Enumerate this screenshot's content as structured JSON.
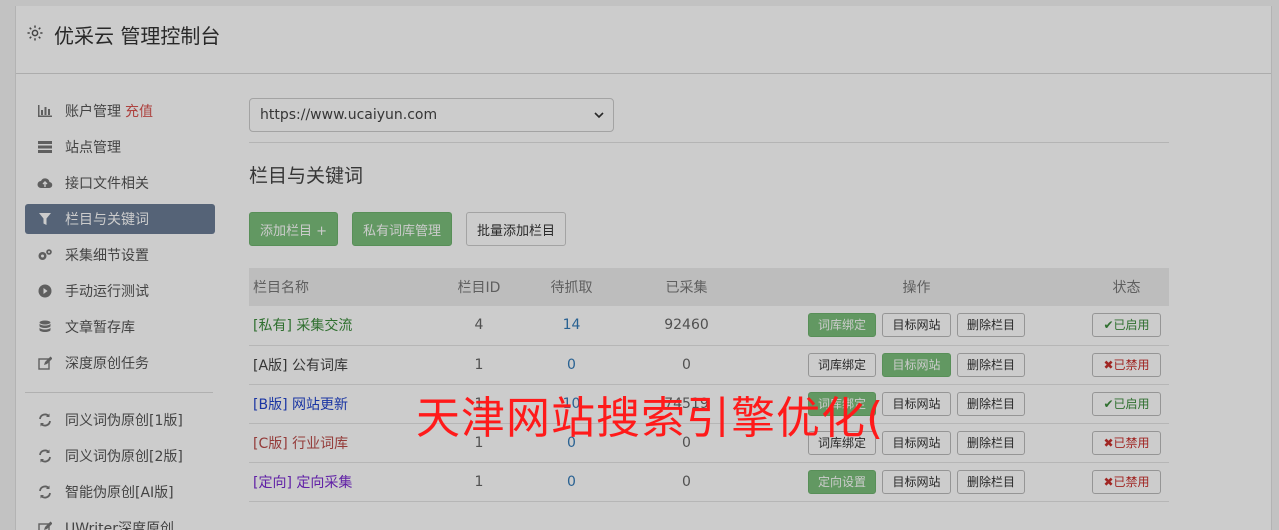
{
  "header": {
    "title": "优采云 管理控制台"
  },
  "sidebar": {
    "items": [
      {
        "label": "账户管理",
        "extra": "充值",
        "icon": "bar-chart-icon"
      },
      {
        "label": "站点管理",
        "icon": "server-icon"
      },
      {
        "label": "接口文件相关",
        "icon": "cloud-upload-icon"
      },
      {
        "label": "栏目与关键词",
        "icon": "filter-icon",
        "active": true
      },
      {
        "label": "采集细节设置",
        "icon": "cogs-icon"
      },
      {
        "label": "手动运行测试",
        "icon": "play-circle-icon"
      },
      {
        "label": "文章暂存库",
        "icon": "database-icon"
      },
      {
        "label": "深度原创任务",
        "icon": "edit-icon"
      }
    ],
    "items2": [
      {
        "label": "同义词伪原创[1版]",
        "icon": "refresh-icon"
      },
      {
        "label": "同义词伪原创[2版]",
        "icon": "refresh-icon"
      },
      {
        "label": "智能伪原创[AI版]",
        "icon": "refresh-icon"
      },
      {
        "label": "UWriter深度原创",
        "icon": "edit-icon"
      }
    ]
  },
  "main": {
    "site_select_value": "https://www.ucaiyun.com",
    "section_title": "栏目与关键词",
    "buttons": {
      "add_column": "添加栏目 +",
      "private_lexicon": "私有词库管理",
      "batch_add": "批量添加栏目"
    },
    "table": {
      "headers": [
        "栏目名称",
        "栏目ID",
        "待抓取",
        "已采集",
        "操作",
        "状态"
      ],
      "rows": [
        {
          "name": "[私有] 采集交流",
          "id": "4",
          "pending": "14",
          "collected": "92460",
          "op1": "词库绑定",
          "op2": "目标网站",
          "op3": "删除栏目",
          "status": "已启用"
        },
        {
          "name": "[A版] 公有词库",
          "id": "1",
          "pending": "0",
          "collected": "0",
          "op1": "词库绑定",
          "op2": "目标网站",
          "op3": "删除栏目",
          "status": "已禁用"
        },
        {
          "name": "[B版] 网站更新",
          "id": "1",
          "pending": "10",
          "collected": "74519",
          "op1": "词库绑定",
          "op2": "目标网站",
          "op3": "删除栏目",
          "status": "已启用"
        },
        {
          "name": "[C版] 行业词库",
          "id": "1",
          "pending": "0",
          "collected": "0",
          "op1": "词库绑定",
          "op2": "目标网站",
          "op3": "删除栏目",
          "status": "已禁用"
        },
        {
          "name": "[定向] 定向采集",
          "id": "1",
          "pending": "0",
          "collected": "0",
          "op1": "定向设置",
          "op2": "目标网站",
          "op3": "删除栏目",
          "status": "已禁用"
        }
      ]
    }
  },
  "watermark": "天津网站搜索引擎优化(",
  "colors": {
    "accent_green": "#7bbf7b",
    "active_nav": "#6b7c95",
    "watermark": "#ff1a1a"
  }
}
